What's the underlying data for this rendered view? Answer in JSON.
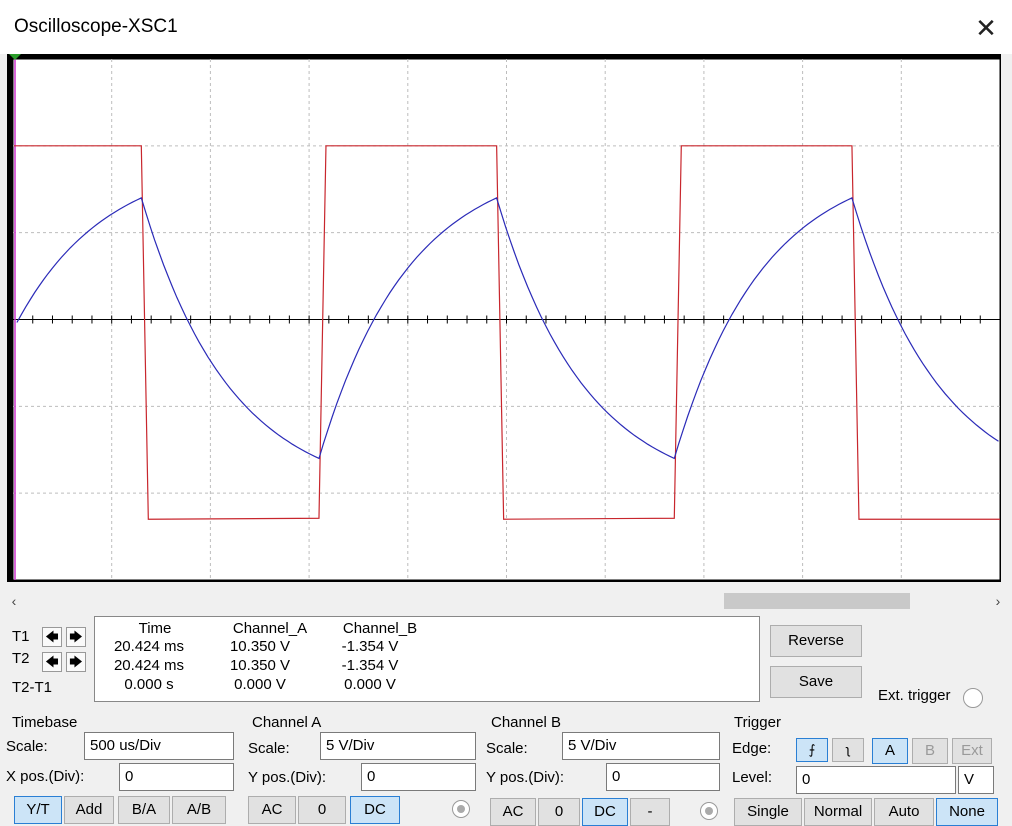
{
  "window": {
    "title": "Oscilloscope-XSC1",
    "close_glyph": "✕"
  },
  "scroll": {
    "left_glyph": "‹",
    "right_glyph": "›"
  },
  "cursors": {
    "t1": "T1",
    "t2": "T2",
    "t2t1": "T2-T1",
    "left_glyph": "🡄",
    "right_glyph": "🡆"
  },
  "readout": {
    "headers": [
      "Time",
      "Channel_A",
      "Channel_B"
    ],
    "rows": [
      [
        "20.424 ms",
        "10.350 V",
        "-1.354 V"
      ],
      [
        "20.424 ms",
        "10.350 V",
        "-1.354 V"
      ],
      [
        "0.000 s",
        "0.000 V",
        "0.000 V"
      ]
    ]
  },
  "side": {
    "reverse": "Reverse",
    "save": "Save",
    "ext_trigger": "Ext. trigger"
  },
  "timebase": {
    "title": "Timebase",
    "scale_label": "Scale:",
    "scale": "500 us/Div",
    "xpos_label": "X pos.(Div):",
    "xpos": "0",
    "modes": [
      "Y/T",
      "Add",
      "B/A",
      "A/B"
    ]
  },
  "channel_a": {
    "title": "Channel A",
    "scale_label": "Scale:",
    "scale": "5  V/Div",
    "ypos_label": "Y pos.(Div):",
    "ypos": "0",
    "coupling": [
      "AC",
      "0",
      "DC"
    ]
  },
  "channel_b": {
    "title": "Channel B",
    "scale_label": "Scale:",
    "scale": "5  V/Div",
    "ypos_label": "Y pos.(Div):",
    "ypos": "0",
    "coupling": [
      "AC",
      "0",
      "DC",
      "-"
    ]
  },
  "trigger": {
    "title": "Trigger",
    "edge_label": "Edge:",
    "edge_rise": "⨍",
    "edge_fall": "ʅ",
    "sources": [
      "A",
      "B",
      "Ext"
    ],
    "level_label": "Level:",
    "level": "0",
    "level_unit": "V",
    "modes": [
      "Single",
      "Normal",
      "Auto",
      "None"
    ]
  },
  "colors": {
    "channel_a": "#c8262d",
    "channel_b": "#2b2bb8",
    "grid": "#bdbdbd",
    "cursor": "#cc33cc"
  },
  "chart_data": {
    "type": "line",
    "xlabel": "",
    "ylabel": "",
    "x_divisions": 10,
    "y_divisions": 6,
    "series": [
      {
        "name": "Channel_A",
        "values_div": [
          2.0,
          -2.3
        ],
        "period_div": 3.6
      },
      {
        "name": "Channel_B",
        "values_div": [
          1.4,
          -1.6
        ],
        "period_div": 3.6
      }
    ]
  }
}
